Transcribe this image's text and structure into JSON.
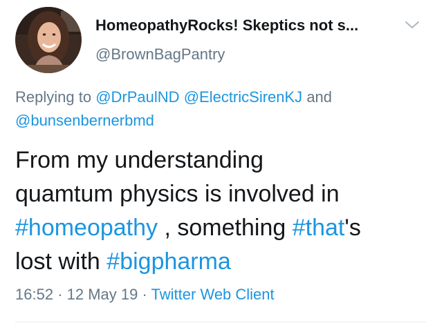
{
  "tweet": {
    "display_name": "HomeopathyRocks! Skeptics not s...",
    "handle": "@BrownBagPantry",
    "replying_prefix": "Replying to",
    "reply_mentions": [
      "@DrPaulND",
      "@ElectricSirenKJ",
      "@bunsenbernerbmd"
    ],
    "reply_and": "and",
    "body": {
      "line1": "From my understanding",
      "line2": "quamtum physics is involved in",
      "hashtag_homeopathy": "#homeopathy",
      "mid_text": ", something",
      "hashtag_that": "#that",
      "after_that": "'s",
      "lost_with": "lost with",
      "hashtag_bigpharma": "#bigpharma"
    },
    "time": "16:52",
    "separator": "·",
    "date": "12 May 19",
    "client": "Twitter Web Client"
  },
  "icons": {
    "caret": "chevron-down-icon"
  },
  "colors": {
    "link": "#1b95e0",
    "secondary_text": "#657786",
    "primary_text": "#14171a",
    "divider": "#e6ecf0"
  }
}
